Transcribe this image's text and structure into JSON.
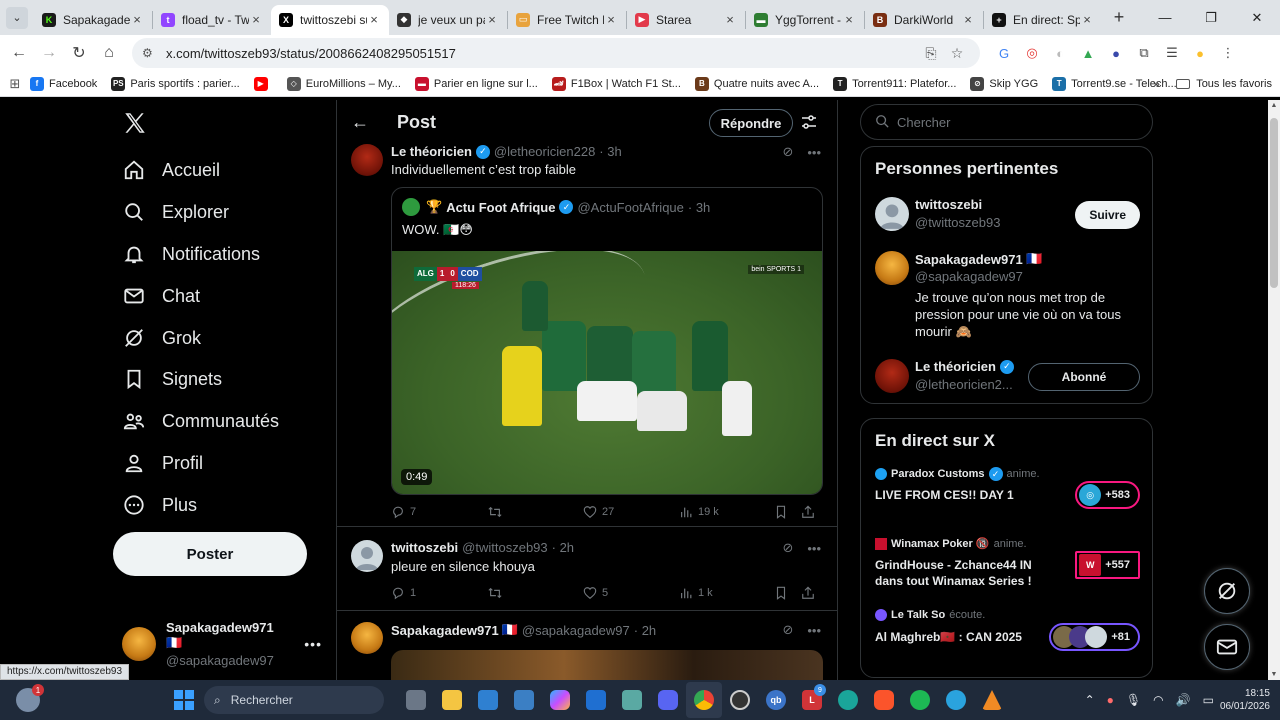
{
  "browser": {
    "tabs": [
      {
        "label": "Sapakagadev",
        "color": "#1a1a1a",
        "glyph": "K",
        "glyph_color": "#53fc18"
      },
      {
        "label": "fload_tv - Twi",
        "color": "#9146ff",
        "glyph": "t"
      },
      {
        "label": "twittoszebi su",
        "color": "#000000",
        "glyph": "X",
        "active": true
      },
      {
        "label": "je veux un pa",
        "color": "#333333",
        "glyph": "◆"
      },
      {
        "label": "Free Twitch R",
        "color": "#e8a33d",
        "glyph": "▭"
      },
      {
        "label": "Starea",
        "color": "#e23a4b",
        "glyph": "▶"
      },
      {
        "label": "YggTorrent -",
        "color": "#2e7d32",
        "glyph": "▬"
      },
      {
        "label": "DarkiWorld",
        "color": "#7a2e12",
        "glyph": "B"
      },
      {
        "label": "En direct: Sp",
        "color": "#111111",
        "glyph": "+"
      }
    ],
    "url": "x.com/twittoszeb93/status/2008662408295051517",
    "bookmarks": [
      {
        "label": "Facebook",
        "color": "#1877f2",
        "glyph": "f"
      },
      {
        "label": "Paris sportifs : parier...",
        "color": "#222222",
        "glyph": "PS"
      },
      {
        "label": "",
        "color": "#ff0000",
        "glyph": "▶"
      },
      {
        "label": "EuroMillions – My...",
        "color": "#555555",
        "glyph": "◇"
      },
      {
        "label": "Parier en ligne sur l...",
        "color": "#c8102e",
        "glyph": "▬"
      },
      {
        "label": "F1Box | Watch F1 St...",
        "color": "#b71c1c",
        "glyph": "🏎"
      },
      {
        "label": "Quatre nuits avec A...",
        "color": "#6b3a1a",
        "glyph": "B"
      },
      {
        "label": "Torrent911: Platefor...",
        "color": "#222222",
        "glyph": "T"
      },
      {
        "label": "Skip YGG",
        "color": "#444444",
        "glyph": "⊘"
      },
      {
        "label": "Torrent9.se - Telech...",
        "color": "#1b6fa8",
        "glyph": "T"
      }
    ],
    "bookmarks_more": "»",
    "all_favorites": "Tous les favoris",
    "status_url": "https://x.com/twittoszeb93"
  },
  "nav": {
    "items": [
      {
        "label": "Accueil",
        "icon": "home-icon"
      },
      {
        "label": "Explorer",
        "icon": "search-icon"
      },
      {
        "label": "Notifications",
        "icon": "bell-icon"
      },
      {
        "label": "Chat",
        "icon": "mail-icon"
      },
      {
        "label": "Grok",
        "icon": "grok-icon"
      },
      {
        "label": "Signets",
        "icon": "bookmark-icon"
      },
      {
        "label": "Communautés",
        "icon": "communities-icon"
      },
      {
        "label": "Profil",
        "icon": "profile-icon"
      },
      {
        "label": "Plus",
        "icon": "more-icon"
      }
    ],
    "post_button": "Poster",
    "account": {
      "name": "Sapakagadew971",
      "flag": "🇫🇷",
      "handle": "@sapakagadew97"
    }
  },
  "post_header": {
    "title": "Post",
    "reply_button": "Répondre"
  },
  "tweets": [
    {
      "name": "Le théoricien",
      "handle": "@letheoricien228",
      "time": "· 3h",
      "text": "Individuellement c’est trop faible",
      "quote": {
        "name": "Actu Foot Afrique",
        "handle": "@ActuFootAfrique",
        "time": "· 3h",
        "emoji": "🏆",
        "text": "WOW. 🇩🇿😳",
        "duration": "0:49",
        "score": {
          "home": "ALG",
          "home_score": "1",
          "away_score": "0",
          "away": "COD",
          "clock": "118:26"
        },
        "broadcast": "bein SPORTS 1"
      },
      "stats": {
        "replies": "7",
        "reposts": "",
        "likes": "27",
        "views": "19 k"
      }
    },
    {
      "name": "twittoszebi",
      "handle": "@twittoszeb93",
      "time": "· 2h",
      "text": "pleure en silence khouya",
      "stats": {
        "replies": "1",
        "reposts": "",
        "likes": "5",
        "views": "1 k"
      }
    },
    {
      "name": "Sapakagadew971",
      "flag": "🇫🇷",
      "handle": "@sapakagadew97",
      "time": "· 2h"
    }
  ],
  "right": {
    "search_placeholder": "Chercher",
    "relevant": {
      "title": "Personnes pertinentes",
      "people": [
        {
          "name": "twittoszebi",
          "handle": "@twittoszeb93",
          "button": "Suivre"
        },
        {
          "name": "Sapakagadew971",
          "flag": "🇫🇷",
          "handle": "@sapakagadew97",
          "bio": "Je trouve qu’on nous met trop de pression pour une vie où on va tous mourir 🙈"
        },
        {
          "name": "Le théoricien",
          "handle": "@letheoricien2...",
          "button": "Abonné",
          "verified": true
        }
      ]
    },
    "live": {
      "title": "En direct sur X",
      "items": [
        {
          "host": "Paradox Customs",
          "host_verified": true,
          "anim": "anime.",
          "title": "LIVE FROM CES!! DAY 1",
          "count": "+583"
        },
        {
          "host": "Winamax Poker 🔞",
          "anim": "anime.",
          "title": "GrindHouse - Zchance44 IN dans tout Winamax Series !",
          "count": "+557"
        },
        {
          "host": "Le Talk So",
          "anim": "écoute.",
          "title": "Al Maghreb🇲🇦 : CAN 2025",
          "count": "+81"
        }
      ]
    }
  },
  "taskbar": {
    "search": "Rechercher",
    "weather_badge": "1",
    "time": "18:15",
    "date": "06/01/2026",
    "app_badge": "9"
  }
}
